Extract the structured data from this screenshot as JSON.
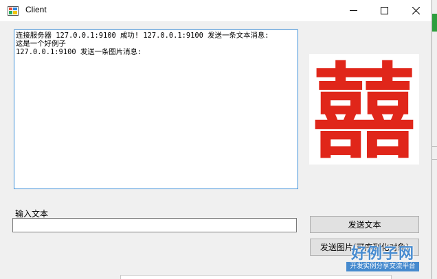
{
  "window": {
    "title": "Client"
  },
  "log": {
    "lines": [
      "连接服务器 127.0.0.1:9100 成功! 127.0.0.1:9100 发送一条文本消息:",
      "这是一个好例子",
      "127.0.0.1:9100 发送一条图片消息:"
    ]
  },
  "picture": {
    "glyph": "囍",
    "color": "#e0261a"
  },
  "input": {
    "label": "输入文本",
    "value": ""
  },
  "buttons": {
    "send_text": "发送文本",
    "send_image": "发送图片(可序列化对象)"
  },
  "watermark": {
    "title": "好例子网",
    "subtitle": "开发实例分享交流平台"
  }
}
